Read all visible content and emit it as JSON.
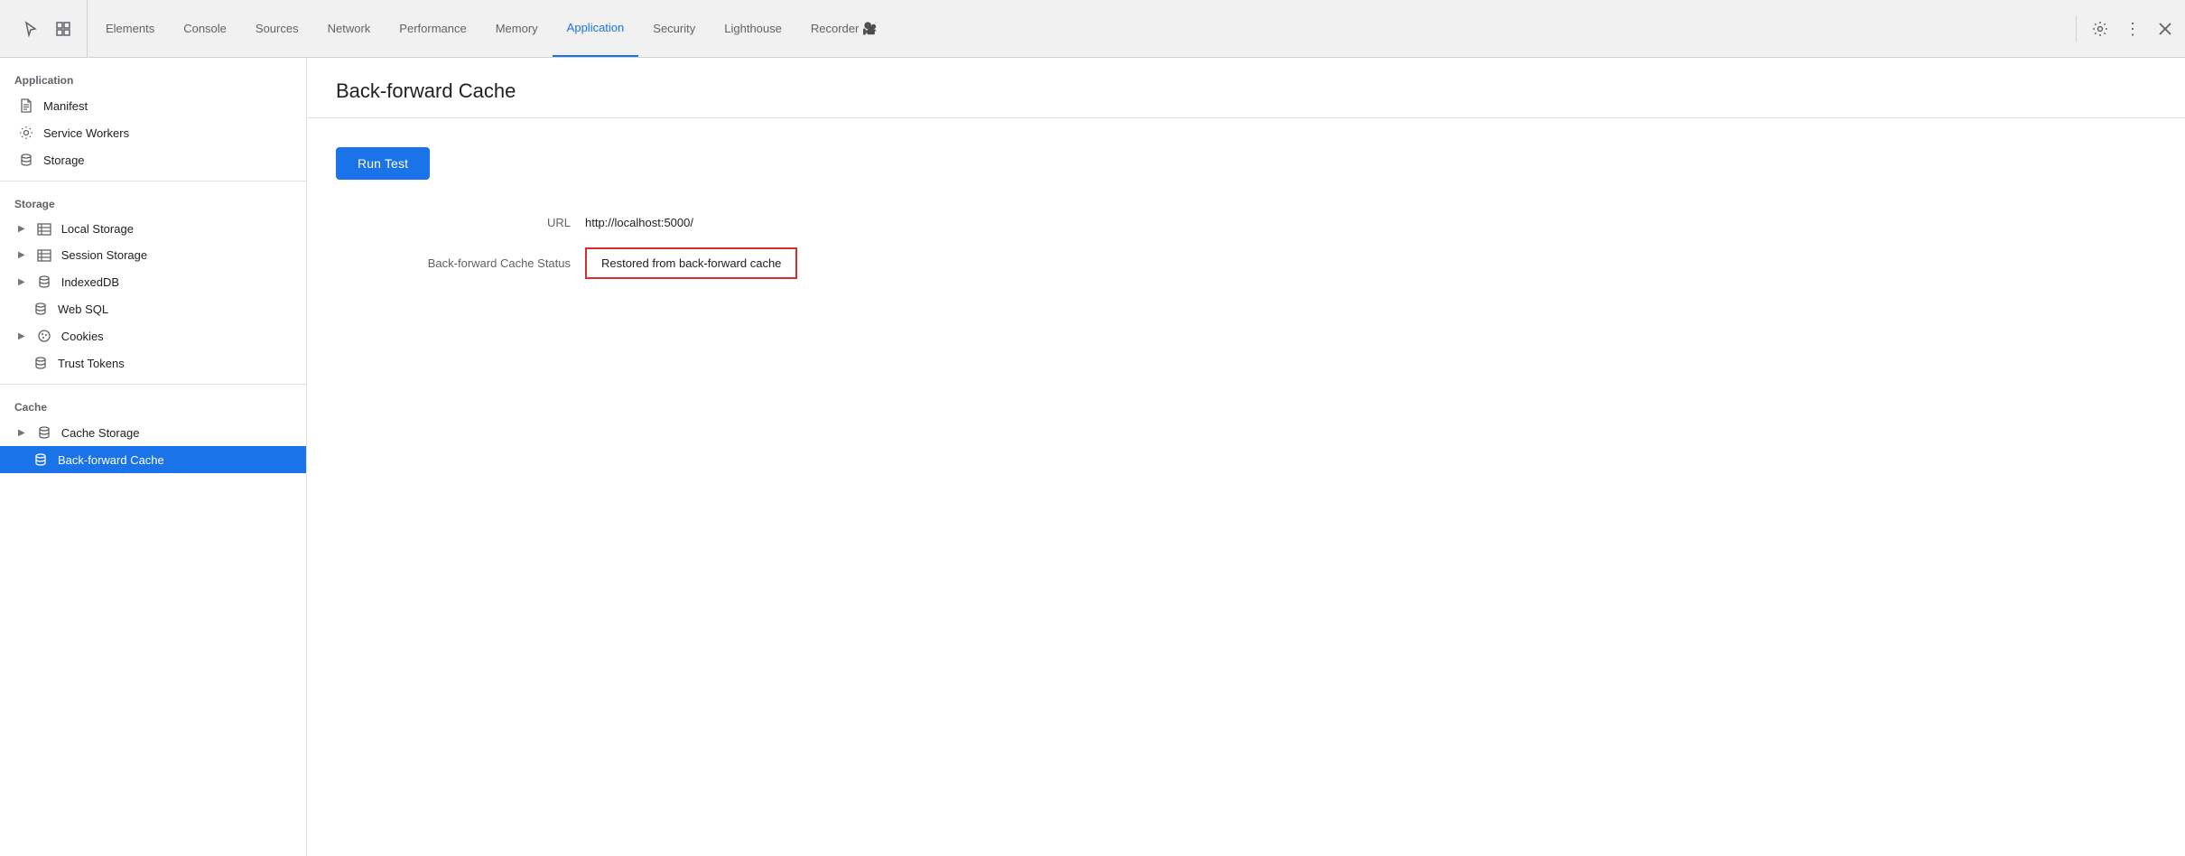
{
  "tabs": [
    {
      "id": "elements",
      "label": "Elements",
      "active": false
    },
    {
      "id": "console",
      "label": "Console",
      "active": false
    },
    {
      "id": "sources",
      "label": "Sources",
      "active": false
    },
    {
      "id": "network",
      "label": "Network",
      "active": false
    },
    {
      "id": "performance",
      "label": "Performance",
      "active": false
    },
    {
      "id": "memory",
      "label": "Memory",
      "active": false
    },
    {
      "id": "application",
      "label": "Application",
      "active": true
    },
    {
      "id": "security",
      "label": "Security",
      "active": false
    },
    {
      "id": "lighthouse",
      "label": "Lighthouse",
      "active": false
    },
    {
      "id": "recorder",
      "label": "Recorder 🎥",
      "active": false
    }
  ],
  "sidebar": {
    "application_section": "Application",
    "storage_section": "Storage",
    "cache_section": "Cache",
    "items": {
      "application": [
        {
          "id": "manifest",
          "label": "Manifest",
          "icon": "file",
          "expandable": false
        },
        {
          "id": "service-workers",
          "label": "Service Workers",
          "icon": "gear",
          "expandable": false
        },
        {
          "id": "storage",
          "label": "Storage",
          "icon": "db",
          "expandable": false
        }
      ],
      "storage": [
        {
          "id": "local-storage",
          "label": "Local Storage",
          "icon": "table",
          "expandable": true
        },
        {
          "id": "session-storage",
          "label": "Session Storage",
          "icon": "table",
          "expandable": true
        },
        {
          "id": "indexeddb",
          "label": "IndexedDB",
          "icon": "db",
          "expandable": true
        },
        {
          "id": "web-sql",
          "label": "Web SQL",
          "icon": "db",
          "expandable": false
        },
        {
          "id": "cookies",
          "label": "Cookies",
          "icon": "cookie",
          "expandable": true
        },
        {
          "id": "trust-tokens",
          "label": "Trust Tokens",
          "icon": "db",
          "expandable": false
        }
      ],
      "cache": [
        {
          "id": "cache-storage",
          "label": "Cache Storage",
          "icon": "db",
          "expandable": true
        },
        {
          "id": "back-forward-cache",
          "label": "Back-forward Cache",
          "icon": "db",
          "expandable": false,
          "active": true
        }
      ]
    }
  },
  "content": {
    "title": "Back-forward Cache",
    "run_test_label": "Run Test",
    "url_label": "URL",
    "url_value": "http://localhost:5000/",
    "cache_status_label": "Back-forward Cache Status",
    "cache_status_value": "Restored from back-forward cache"
  },
  "colors": {
    "active_tab": "#1a73e8",
    "active_sidebar": "#1a73e8",
    "status_border": "#d32f2f",
    "run_test_bg": "#1a73e8"
  }
}
